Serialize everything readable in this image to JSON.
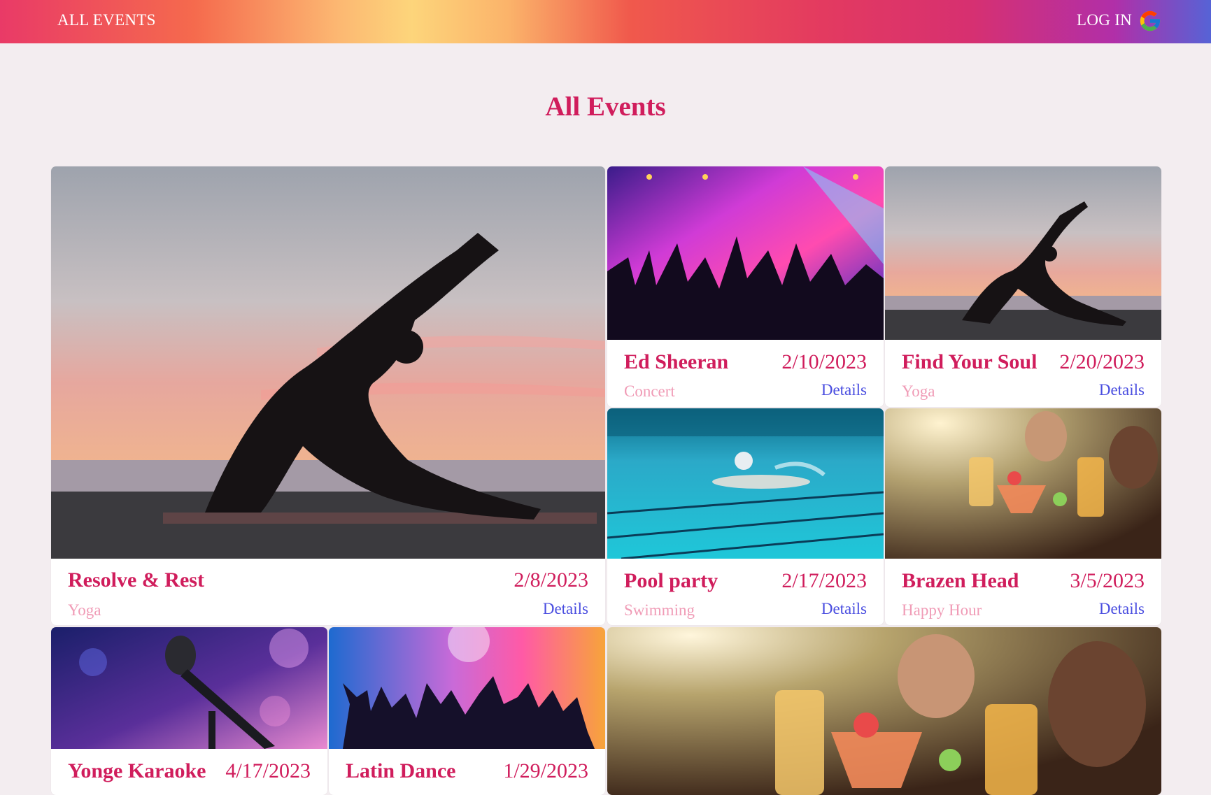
{
  "nav": {
    "all_events": "ALL EVENTS",
    "login": "LOG IN"
  },
  "page": {
    "title": "All Events"
  },
  "colors": {
    "accent": "#d01d5c",
    "category": "#f09bb6",
    "link": "#4a4ee0",
    "background": "#f3edf0"
  },
  "events": [
    {
      "name": "Resolve & Rest",
      "date": "2/8/2023",
      "category": "Yoga",
      "details": "Details",
      "image": "yoga-sunset"
    },
    {
      "name": "Ed Sheeran",
      "date": "2/10/2023",
      "category": "Concert",
      "details": "Details",
      "image": "concert-crowd"
    },
    {
      "name": "Find Your Soul",
      "date": "2/20/2023",
      "category": "Yoga",
      "details": "Details",
      "image": "yoga-sunset"
    },
    {
      "name": "Pool party",
      "date": "2/17/2023",
      "category": "Swimming",
      "details": "Details",
      "image": "swimmer"
    },
    {
      "name": "Brazen Head",
      "date": "3/5/2023",
      "category": "Happy Hour",
      "details": "Details",
      "image": "cocktails-toast"
    },
    {
      "name": "Yonge Karaoke",
      "date": "4/17/2023",
      "category": "",
      "details": "",
      "image": "microphone"
    },
    {
      "name": "Latin Dance",
      "date": "1/29/2023",
      "category": "",
      "details": "",
      "image": "dance-party"
    },
    {
      "name": "",
      "date": "",
      "category": "",
      "details": "",
      "image": "cocktails-toast"
    }
  ]
}
